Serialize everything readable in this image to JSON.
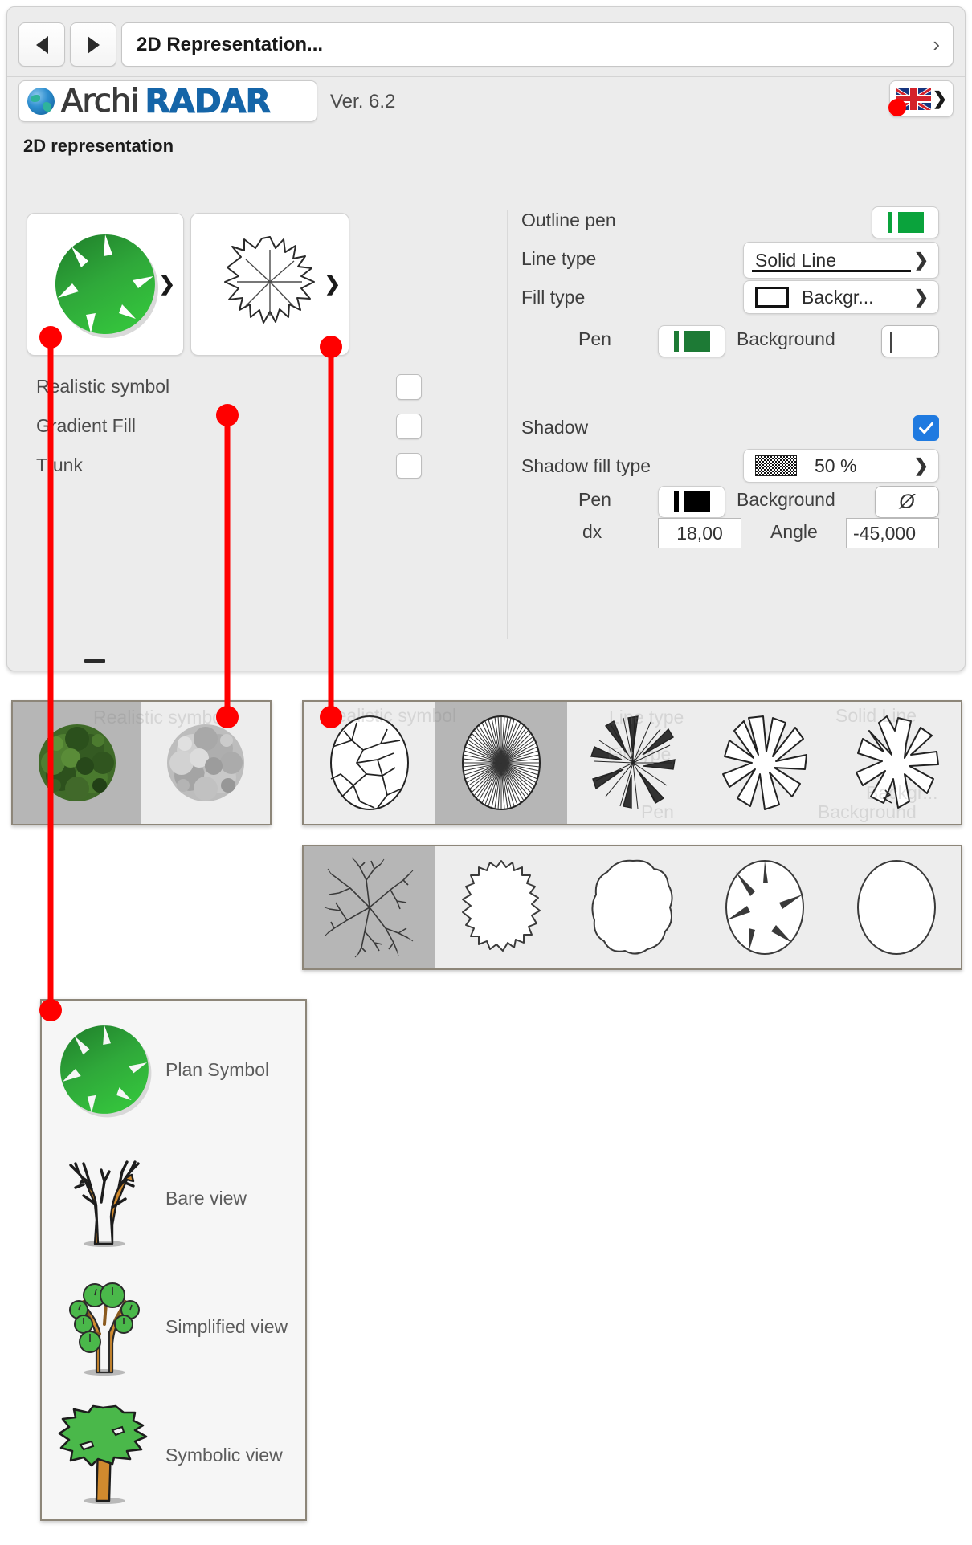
{
  "window": {
    "nav": {
      "back_label": "◀",
      "forward_label": "▶",
      "title": "2D Representation...",
      "disclosure": "›"
    },
    "brand": {
      "name_part1": "Archi",
      "name_part2": "RADAR",
      "version": "Ver. 6.2",
      "language_flag": "uk-flag-icon",
      "language_chevron": "❯"
    },
    "section_title": "2D representation"
  },
  "left_panel": {
    "tiles": [
      {
        "name": "plan-symbol-preview",
        "chevron": "❯"
      },
      {
        "name": "outline-shape-preview",
        "chevron": "❯"
      }
    ],
    "options": [
      {
        "label": "Realistic symbol",
        "checked": false
      },
      {
        "label": "Gradient Fill",
        "checked": false
      },
      {
        "label": "Trunk",
        "checked": false
      }
    ]
  },
  "right_panel": {
    "outline_pen": {
      "label": "Outline pen",
      "color": "#0aa33c"
    },
    "line_type": {
      "label": "Line type",
      "value": "Solid Line",
      "chevron": "❯"
    },
    "fill_type": {
      "label": "Fill type",
      "value": "Backgr...",
      "chevron": "❯"
    },
    "fill_pen": {
      "label": "Pen",
      "color": "#1d7a35"
    },
    "fill_background": {
      "label": "Background",
      "value": ""
    },
    "shadow": {
      "label": "Shadow",
      "checked": true
    },
    "shadow_fill_type": {
      "label": "Shadow fill type",
      "value": "50 %",
      "chevron": "❯"
    },
    "shadow_pen": {
      "label": "Pen",
      "color": "#000000"
    },
    "shadow_background": {
      "label": "Background",
      "value": "Ø"
    },
    "dx": {
      "label": "dx",
      "value": "18,00"
    },
    "angle": {
      "label": "Angle",
      "value": "-45,000"
    }
  },
  "galleries": {
    "realistic": {
      "name": "realistic-symbol-gallery",
      "selected_index": 0,
      "items": [
        {
          "name": "realistic-tree-color"
        },
        {
          "name": "realistic-tree-gray"
        }
      ]
    },
    "outline_top": {
      "name": "outline-symbol-gallery-row1",
      "selected_index": 1,
      "items": [
        {
          "name": "crackle-canopy"
        },
        {
          "name": "dense-radial-canopy"
        },
        {
          "name": "radial-burst-canopy"
        },
        {
          "name": "star-lobed-canopy"
        },
        {
          "name": "jagged-lobed-canopy"
        }
      ]
    },
    "outline_bottom": {
      "name": "outline-symbol-gallery-row2",
      "selected_index": 0,
      "items": [
        {
          "name": "branch-network-canopy"
        },
        {
          "name": "zigzag-outline-canopy"
        },
        {
          "name": "wavy-outline-canopy"
        },
        {
          "name": "notched-circle-canopy"
        },
        {
          "name": "plain-circle-canopy"
        }
      ]
    }
  },
  "view_menu": {
    "name": "tree-view-mode-menu",
    "items": [
      {
        "label": "Plan Symbol",
        "icon": "plan-symbol-icon"
      },
      {
        "label": "Bare view",
        "icon": "bare-tree-icon"
      },
      {
        "label": "Simplified view",
        "icon": "simplified-tree-icon"
      },
      {
        "label": "Symbolic view",
        "icon": "symbolic-tree-icon"
      }
    ]
  },
  "ghost_text": {
    "realistic_symbol": "Realistic symbol",
    "line_type": "Line type",
    "solid_line": "Solid Line",
    "fill_type": "Fill type",
    "backgr": "Backgr...",
    "pen": "Pen",
    "background": "Background"
  },
  "annotation": {
    "color": "#ff0000",
    "callouts": [
      {
        "name": "callout-plan-symbol-to-menu"
      },
      {
        "name": "callout-realistic-gallery"
      },
      {
        "name": "callout-outline-gallery"
      }
    ]
  }
}
